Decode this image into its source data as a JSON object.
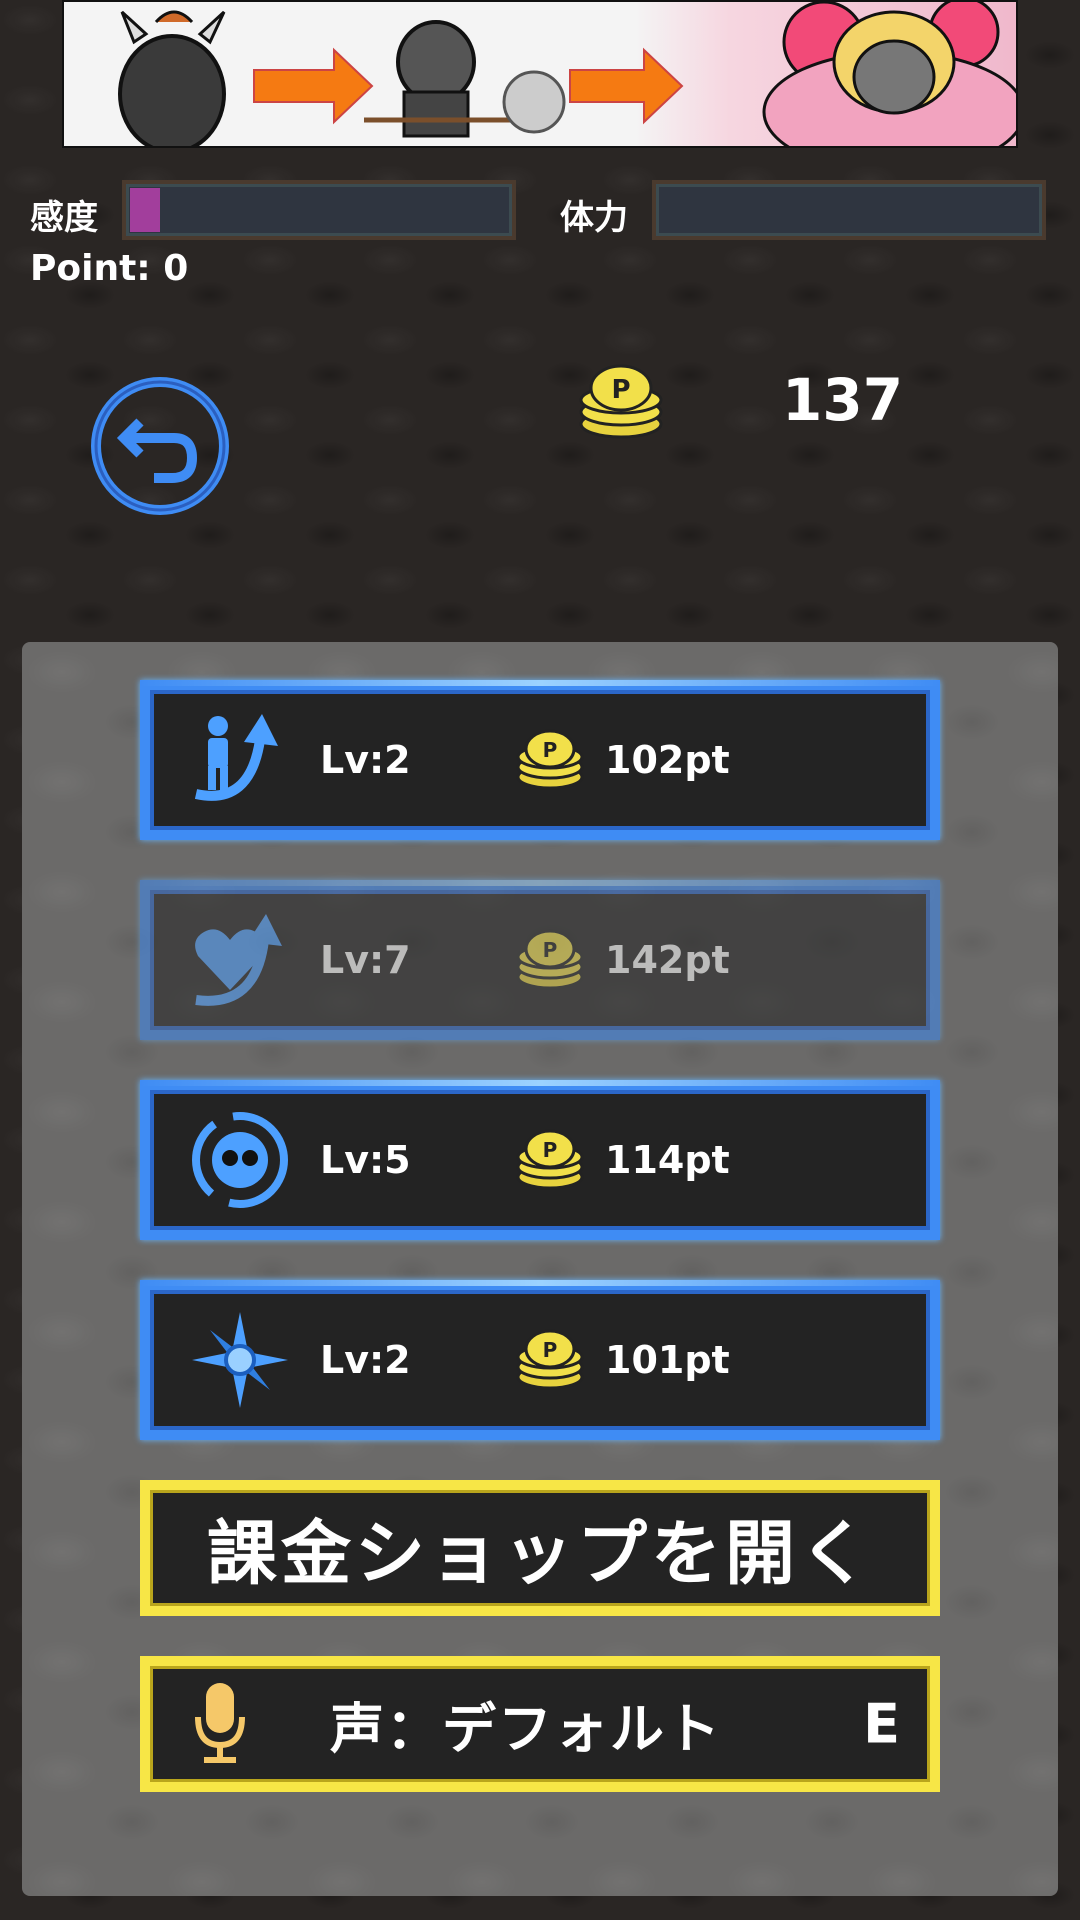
{
  "gauges": {
    "sensitivity": {
      "label": "感度",
      "fill_fraction": 0.08,
      "color": "#a23e9c"
    },
    "stamina": {
      "label": "体力",
      "fill_fraction": 0.0
    }
  },
  "points": {
    "text": "Point:  0"
  },
  "coins": {
    "total": "137",
    "icon": "p-coin-stack-icon"
  },
  "back_button": {
    "icon": "back-arrow-icon"
  },
  "upgrades": [
    {
      "icon": "person-up-icon",
      "level": "Lv:2",
      "cost": "102pt",
      "enabled": true
    },
    {
      "icon": "heart-up-icon",
      "level": "Lv:7",
      "cost": "142pt",
      "enabled": false
    },
    {
      "icon": "swirl-face-icon",
      "level": "Lv:5",
      "cost": "114pt",
      "enabled": true
    },
    {
      "icon": "compass-star-icon",
      "level": "Lv:2",
      "cost": "101pt",
      "enabled": true
    }
  ],
  "shop_button": {
    "label": "課金ショップを開く"
  },
  "voice_button": {
    "icon": "microphone-icon",
    "label": "声：デフォルト",
    "key": "E"
  },
  "colors": {
    "accent_blue": "#3f8cf4",
    "accent_yellow": "#f7e646",
    "coin_yellow": "#f2e04a"
  }
}
